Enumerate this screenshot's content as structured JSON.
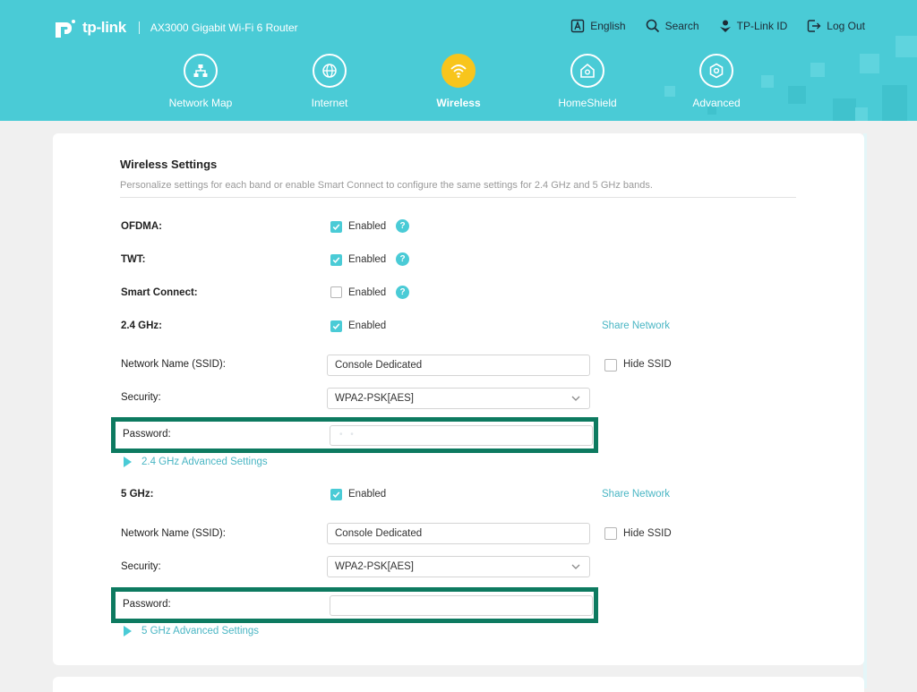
{
  "header": {
    "logo_text": "tp-link",
    "model": "AX3000 Gigabit Wi-Fi 6 Router",
    "top_links": [
      {
        "label": "English",
        "icon": "language-icon"
      },
      {
        "label": "Search",
        "icon": "search-icon"
      },
      {
        "label": "TP-Link ID",
        "icon": "user-icon"
      },
      {
        "label": "Log Out",
        "icon": "logout-icon"
      }
    ],
    "nav": [
      {
        "label": "Network Map",
        "icon": "network-map-icon"
      },
      {
        "label": "Internet",
        "icon": "globe-icon"
      },
      {
        "label": "Wireless",
        "icon": "wifi-icon",
        "active": true
      },
      {
        "label": "HomeShield",
        "icon": "homeshield-icon"
      },
      {
        "label": "Advanced",
        "icon": "gear-icon"
      }
    ]
  },
  "wireless": {
    "title": "Wireless Settings",
    "description": "Personalize settings for each band or enable Smart Connect to configure the same settings for 2.4 GHz and 5 GHz bands.",
    "ofdma": {
      "label": "OFDMA:",
      "option": "Enabled",
      "checked": true
    },
    "twt": {
      "label": "TWT:",
      "option": "Enabled",
      "checked": true
    },
    "smart_connect": {
      "label": "Smart Connect:",
      "option": "Enabled",
      "checked": false
    },
    "band_24": {
      "label": "2.4 GHz:",
      "option": "Enabled",
      "checked": true,
      "share": "Share Network",
      "ssid_label": "Network Name (SSID):",
      "ssid_value": "Console Dedicated",
      "hide_ssid": "Hide SSID",
      "security_label": "Security:",
      "security_value": "WPA2-PSK[AES]",
      "password_label": "Password:",
      "password_mask": "• •",
      "advanced": "2.4 GHz Advanced Settings"
    },
    "band_5": {
      "label": "5 GHz:",
      "option": "Enabled",
      "checked": true,
      "share": "Share Network",
      "ssid_label": "Network Name (SSID):",
      "ssid_value": "Console Dedicated",
      "hide_ssid": "Hide SSID",
      "security_label": "Security:",
      "security_value": "WPA2-PSK[AES]",
      "password_label": "Password:",
      "advanced": "5 GHz Advanced Settings"
    }
  },
  "colors": {
    "header": "#4acbd6",
    "accent": "#4acbd6",
    "active_nav": "#f8c51c",
    "highlight_border": "#0d7a60",
    "link": "#4ab6c4"
  }
}
